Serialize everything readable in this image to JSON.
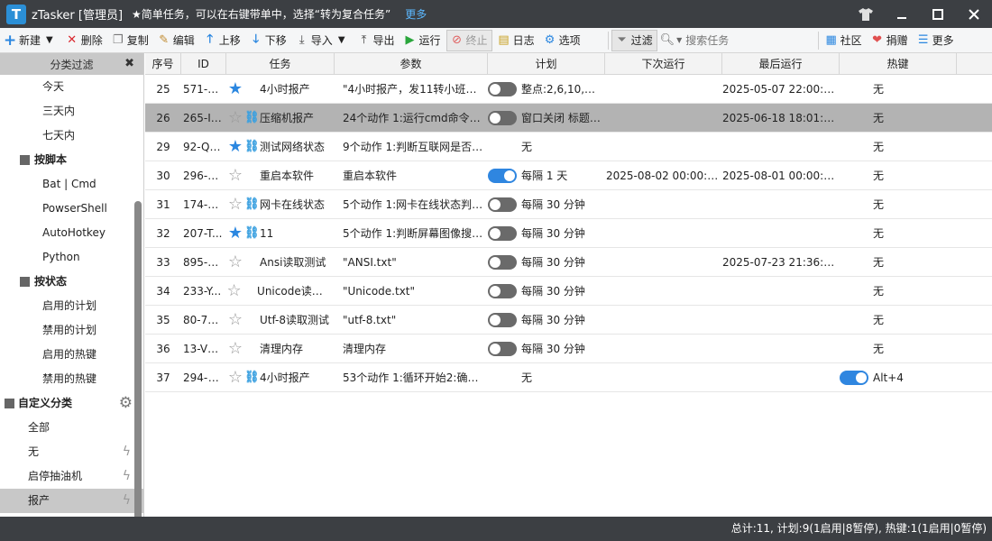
{
  "titlebar": {
    "logo": "T",
    "title": "zTasker [管理员]",
    "tip": "★简单任务，可以在右键带单中，选择“转为复合任务”",
    "more": "更多",
    "icons": [
      "shirt-icon",
      "minimize-icon",
      "maximize-icon",
      "close-icon"
    ]
  },
  "toolbar": {
    "new": "新建",
    "delete": "删除",
    "copy": "复制",
    "edit": "编辑",
    "up": "上移",
    "down": "下移",
    "import": "导入",
    "export": "导出",
    "run": "运行",
    "stop": "终止",
    "log": "日志",
    "options": "选项",
    "filter": "过滤",
    "search_placeholder": "搜索任务",
    "community": "社区",
    "donate": "捐赠",
    "more": "更多"
  },
  "sidebar": {
    "header": "分类过滤",
    "time_items": [
      "今天",
      "三天内",
      "七天内"
    ],
    "script_group": "按脚本",
    "script_items": [
      "Bat | Cmd",
      "PowserShell",
      "AutoHotkey",
      "Python"
    ],
    "state_group": "按状态",
    "state_items": [
      "启用的计划",
      "禁用的计划",
      "启用的热键",
      "禁用的热键"
    ],
    "custom_group": "自定义分类",
    "custom_items": [
      "全部",
      "无",
      "启停抽油机",
      "报产"
    ],
    "selected_custom": "报产"
  },
  "grid": {
    "headers": [
      "序号",
      "ID",
      "任务",
      "参数",
      "计划",
      "下次运行",
      "最后运行",
      "热键"
    ],
    "rows": [
      {
        "no": "25",
        "id": "571-RI...",
        "star": true,
        "link": false,
        "task": "4小时报产",
        "param": "\"4小时报产，发11转小班群\" ...",
        "toggle": "off",
        "plan": "整点:2,6,10,14,...",
        "next": "",
        "last": "2025-05-07 22:00:01",
        "hot_toggle": "none",
        "hot": "无",
        "selected": false
      },
      {
        "no": "26",
        "id": "265-IU...",
        "star": false,
        "link": true,
        "task": "压缩机报产",
        "param": "24个动作 1:运行cmd命令2:延...",
        "toggle": "off",
        "plan": "窗口关闭 标题:...",
        "next": "",
        "last": "2025-06-18 18:01:08",
        "hot_toggle": "none",
        "hot": "无",
        "selected": true
      },
      {
        "no": "29",
        "id": "92-QH...",
        "star": true,
        "link": true,
        "task": "测试网络状态",
        "param": "9个动作 1:判断互联网是否在...",
        "toggle": "none",
        "plan": "无",
        "next": "",
        "last": "",
        "hot_toggle": "none",
        "hot": "无",
        "selected": false
      },
      {
        "no": "30",
        "id": "296-R...",
        "star": false,
        "link": false,
        "task": "重启本软件",
        "param": "重启本软件",
        "toggle": "on",
        "plan": "每隔 1 天",
        "next": "2025-08-02 00:00:00...",
        "last": "2025-08-01 00:00:00",
        "hot_toggle": "none",
        "hot": "无",
        "selected": false
      },
      {
        "no": "31",
        "id": "174-K...",
        "star": false,
        "link": true,
        "task": "网卡在线状态",
        "param": "5个动作 1:网卡在线状态判断2...",
        "toggle": "off",
        "plan": "每隔 30 分钟",
        "next": "",
        "last": "",
        "hot_toggle": "none",
        "hot": "无",
        "selected": false
      },
      {
        "no": "32",
        "id": "207-T...",
        "star": true,
        "link": true,
        "task": "11",
        "param": "5个动作 1:判断屏幕图像搜索...",
        "toggle": "off",
        "plan": "每隔 30 分钟",
        "next": "",
        "last": "",
        "hot_toggle": "none",
        "hot": "无",
        "selected": false
      },
      {
        "no": "33",
        "id": "895-M...",
        "star": false,
        "link": false,
        "task": "Ansi读取测试",
        "param": "\"ANSI.txt\"",
        "toggle": "off",
        "plan": "每隔 30 分钟",
        "next": "",
        "last": "2025-07-23 21:36:59",
        "hot_toggle": "none",
        "hot": "无",
        "selected": false
      },
      {
        "no": "34",
        "id": "233-Y...",
        "star": false,
        "link": false,
        "task": "Unicode读取测...",
        "param": "\"Unicode.txt\"",
        "toggle": "off",
        "plan": "每隔 30 分钟",
        "next": "",
        "last": "",
        "hot_toggle": "none",
        "hot": "无",
        "selected": false
      },
      {
        "no": "35",
        "id": "80-75I...",
        "star": false,
        "link": false,
        "task": "Utf-8读取测试",
        "param": "\"utf-8.txt\"",
        "toggle": "off",
        "plan": "每隔 30 分钟",
        "next": "",
        "last": "",
        "hot_toggle": "none",
        "hot": "无",
        "selected": false
      },
      {
        "no": "36",
        "id": "13-VZ...",
        "star": false,
        "link": false,
        "task": "清理内存",
        "param": "清理内存",
        "toggle": "off",
        "plan": "每隔 30 分钟",
        "next": "",
        "last": "",
        "hot_toggle": "none",
        "hot": "无",
        "selected": false
      },
      {
        "no": "37",
        "id": "294-G...",
        "star": false,
        "link": true,
        "task": "4小时报产",
        "param": "53个动作 1:循环开始2:确定外...",
        "toggle": "none",
        "plan": "无",
        "next": "",
        "last": "",
        "hot_toggle": "on",
        "hot": "Alt+4",
        "selected": false
      }
    ]
  },
  "status": {
    "text": "总计:11, 计划:9(1启用|8暂停), 热键:1(1启用|0暂停)"
  },
  "colors": {
    "titlebar_bg": "#3c3f43",
    "accent": "#2f86e0",
    "selected_row": "#b3b3b3"
  }
}
